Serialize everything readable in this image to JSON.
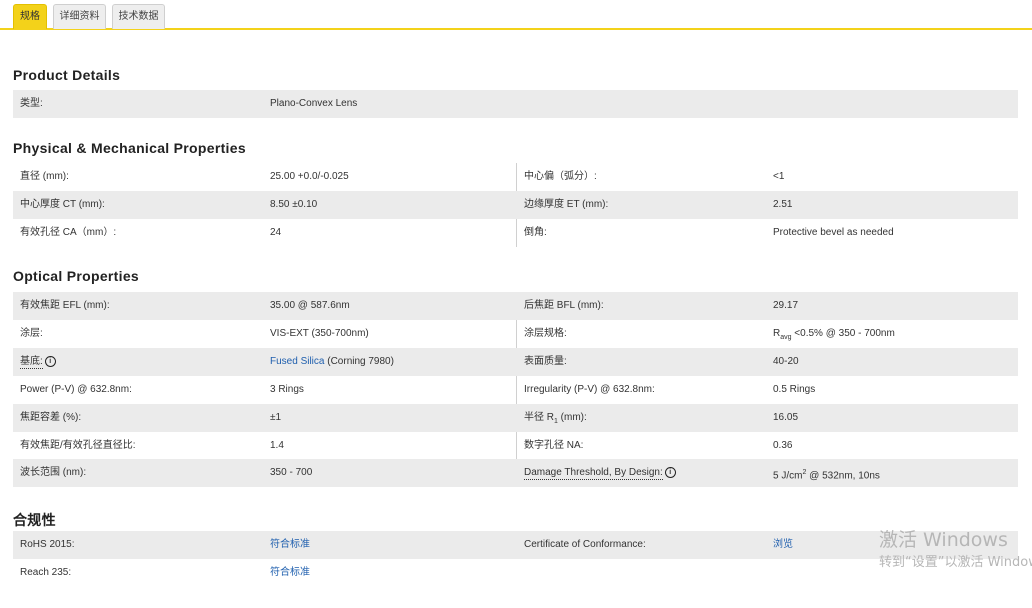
{
  "tabs": [
    {
      "label": "规格",
      "active": true
    },
    {
      "label": "详细资料",
      "active": false
    },
    {
      "label": "技术数据",
      "active": false
    }
  ],
  "sections": {
    "product_details": {
      "title": "Product Details",
      "rows": [
        {
          "k1": "类型:",
          "v1": "Plano-Convex Lens"
        }
      ]
    },
    "physical": {
      "title": "Physical & Mechanical Properties",
      "rows": [
        {
          "k1": "直径 (mm):",
          "v1": "25.00 +0.0/-0.025",
          "k2": "中心偏（弧分）:",
          "v2": "<1"
        },
        {
          "k1": "中心厚度 CT (mm):",
          "v1": "8.50 ±0.10",
          "k2": "边缘厚度 ET (mm):",
          "v2": "2.51"
        },
        {
          "k1": "有效孔径 CA（mm）:",
          "v1": "24",
          "k2": "倒角:",
          "v2": "Protective bevel as needed"
        }
      ]
    },
    "optical": {
      "title": "Optical Properties",
      "rows": [
        {
          "k1": "有效焦距 EFL (mm):",
          "v1": "35.00 @ 587.6nm",
          "k2": "后焦距 BFL (mm):",
          "v2": "29.17"
        },
        {
          "k1": "涂层:",
          "v1": "VIS-EXT (350-700nm)",
          "k2": "涂层规格:",
          "v2_main": "R",
          "v2_sub": "avg",
          "v2_rest": " <0.5% @ 350 - 700nm"
        },
        {
          "k1": "基底:",
          "v1_link": "Fused Silica",
          "v1_rest": " (Corning 7980)",
          "k2": "表面质量:",
          "v2": "40-20"
        },
        {
          "k1": "Power (P-V) @ 632.8nm:",
          "v1": "3 Rings",
          "k2": "Irregularity (P-V) @ 632.8nm:",
          "v2": "0.5 Rings"
        },
        {
          "k1": "焦距容差 (%):",
          "v1": "±1",
          "k2_main": "半径 R",
          "k2_sub": "1",
          "k2_rest": " (mm):",
          "v2": "16.05"
        },
        {
          "k1": "有效焦距/有效孔径直径比:",
          "v1": "1.4",
          "k2": "数字孔径 NA:",
          "v2": "0.36"
        },
        {
          "k1": "波长范围 (nm):",
          "v1": "350 - 700",
          "k2": "Damage Threshold, By Design:",
          "v2_main": "5 J/cm",
          "v2_sup": "2",
          "v2_rest": " @ 532nm, 10ns"
        }
      ]
    },
    "compliance": {
      "title": "合规性",
      "rows": [
        {
          "k1": "RoHS 2015:",
          "v1": "符合标准",
          "k2": "Certificate of Conformance:",
          "v2": "浏览"
        },
        {
          "k1": "Reach 235:",
          "v1": "符合标准"
        }
      ]
    }
  },
  "watermark": {
    "line1": "激活 Windows",
    "line2": "转到“设置”以激活 Windows。"
  },
  "colors": {
    "accent": "#f3d21a",
    "link": "#1f5fae",
    "row_shade": "#ebebeb"
  }
}
